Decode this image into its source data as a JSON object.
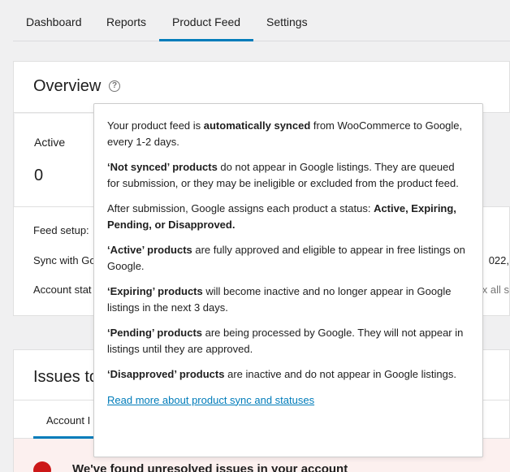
{
  "nav": {
    "tabs": [
      {
        "label": "Dashboard",
        "active": false
      },
      {
        "label": "Reports",
        "active": false
      },
      {
        "label": "Product Feed",
        "active": true
      },
      {
        "label": "Settings",
        "active": false
      }
    ]
  },
  "overview": {
    "title": "Overview",
    "help_icon_glyph": "?",
    "stat": {
      "label": "Active",
      "value": "0"
    },
    "rows": {
      "feed_setup": "Feed setup:",
      "sync_with": "Sync with Go",
      "account_status": "Account stat"
    },
    "right_fragments": {
      "date": "022,",
      "all": "x all s"
    }
  },
  "issues": {
    "title": "Issues to",
    "tab_label": "Account I",
    "banner_text": "We've found unresolved issues in your account"
  },
  "popover": {
    "p1_pre": "Your product feed is ",
    "p1_bold": "automatically synced",
    "p1_post": " from WooCommerce to Google, every 1-2 days.",
    "p2_bold": "‘Not synced’ products",
    "p2_post": " do not appear in Google listings. They are queued for submission, or they may be ineligible or excluded from the product feed.",
    "p3_pre": "After submission, Google assigns each product a status: ",
    "p3_bold": "Active, Expiring, Pending, or Disapproved.",
    "p4_bold": "‘Active’ products",
    "p4_post": " are fully approved and eligible to appear in free listings on Google.",
    "p5_bold": "‘Expiring’ products",
    "p5_post": " will become inactive and no longer appear in Google listings in the next 3 days.",
    "p6_bold": "‘Pending’ products",
    "p6_post": " are being processed by Google. They will not appear in listings until they are approved.",
    "p7_bold": "‘Disapproved’ products",
    "p7_post": " are inactive and do not appear in Google listings.",
    "link": "Read more about product sync and statuses"
  },
  "colors": {
    "accent": "#007cba",
    "error": "#cc1818",
    "banner_bg": "#fcf0ef"
  }
}
